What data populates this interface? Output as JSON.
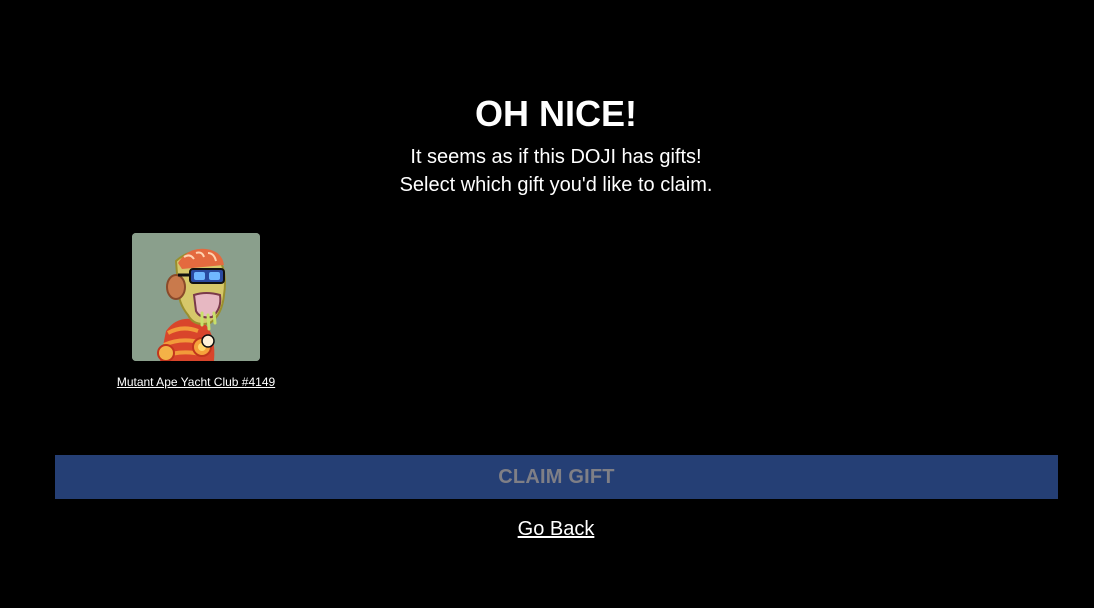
{
  "header": {
    "title": "OH NICE!",
    "subtitle_line1": "It seems as if this DOJI has gifts!",
    "subtitle_line2": "Select which gift you'd like to claim."
  },
  "gifts": [
    {
      "name": "Mutant Ape Yacht Club #4149",
      "image_icon": "mutant-ape-nft-image",
      "background_color": "#8a9f8c"
    }
  ],
  "actions": {
    "claim_label": "CLAIM GIFT",
    "claim_bg_color": "#253f75",
    "claim_text_color": "#7f7f86",
    "go_back_label": "Go Back"
  }
}
